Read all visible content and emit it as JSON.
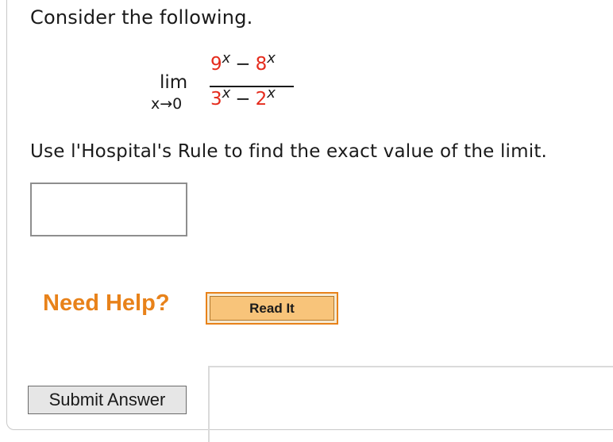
{
  "question": {
    "prompt": "Consider the following.",
    "instruction": "Use l'Hospital's Rule to find the exact value of the limit."
  },
  "limit": {
    "word": "lim",
    "approach": "x→0",
    "numerator": {
      "term1_base": "9",
      "operator": "−",
      "term2_base": "8",
      "exponent": "x"
    },
    "denominator": {
      "term1_base": "3",
      "operator": "−",
      "term2_base": "2",
      "exponent": "x"
    }
  },
  "answer": {
    "value": ""
  },
  "help": {
    "label": "Need Help?",
    "read_it_label": "Read It"
  },
  "actions": {
    "submit_label": "Submit Answer"
  },
  "colors": {
    "variable_red": "#e52b1c",
    "help_orange": "#e8821a"
  }
}
